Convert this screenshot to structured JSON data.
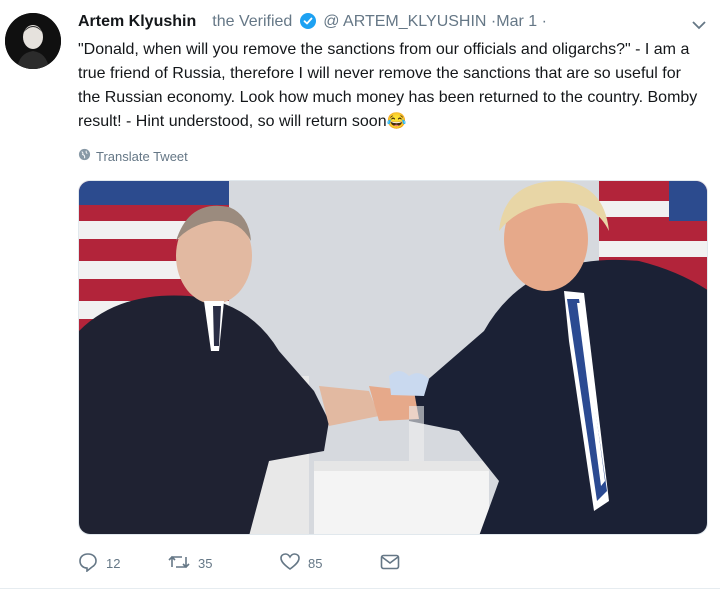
{
  "author": {
    "name": "Artem Klyushin",
    "verified_text": " the Verified",
    "handle": "@ ARTEM_KLYUSHIN",
    "separator": "·",
    "date": "Mar 1",
    "separator2": "·"
  },
  "tweet": {
    "text": "\"Donald, when will you remove the sanctions from our officials and oligarchs?\" - I am a true friend of Russia, therefore I will never remove the sanctions that are so useful for the Russian economy. Look how much money has been returned to the country. Bomby result! - Hint understood, so will return soon😂"
  },
  "translate_label": "Translate Tweet",
  "counts": {
    "replies": "12",
    "retweets": "35",
    "likes": "85"
  },
  "icons": {
    "verified": "verified-badge-icon",
    "menu": "chevron-down-icon",
    "translate": "globe-icon",
    "reply": "reply-icon",
    "retweet": "retweet-icon",
    "like": "heart-icon",
    "dm": "envelope-icon"
  },
  "colors": {
    "verified": "#1da1f2",
    "muted": "#657786",
    "text": "#14171a"
  }
}
